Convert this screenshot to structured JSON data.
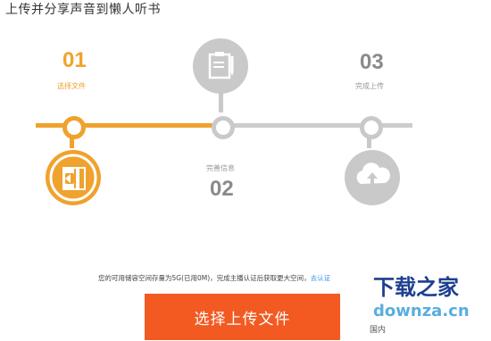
{
  "page": {
    "title": "上传并分享声音到懒人听书"
  },
  "steps": [
    {
      "number": "01",
      "label": "选择文件",
      "state": "active"
    },
    {
      "number": "02",
      "label": "完善信息",
      "state": "idle"
    },
    {
      "number": "03",
      "label": "完成上传",
      "state": "idle"
    }
  ],
  "icons": {
    "step1": "upload-file-icon",
    "step2": "clipboard-edit-icon",
    "step3": "cloud-upload-icon"
  },
  "colors": {
    "accent": "#f0a22e",
    "button": "#f25a22",
    "inactive": "#c9c9c9",
    "link": "#3a8ee6"
  },
  "notice": {
    "text": "您的可用储容空间存量为5G(已用0M)，完成主播认证后获取更大空间，",
    "link": "去认证"
  },
  "upload_button": {
    "label": "选择上传文件"
  },
  "footer": {
    "text": "国内"
  },
  "watermark": {
    "brand": "下载之家",
    "domain": "downza.cn"
  }
}
